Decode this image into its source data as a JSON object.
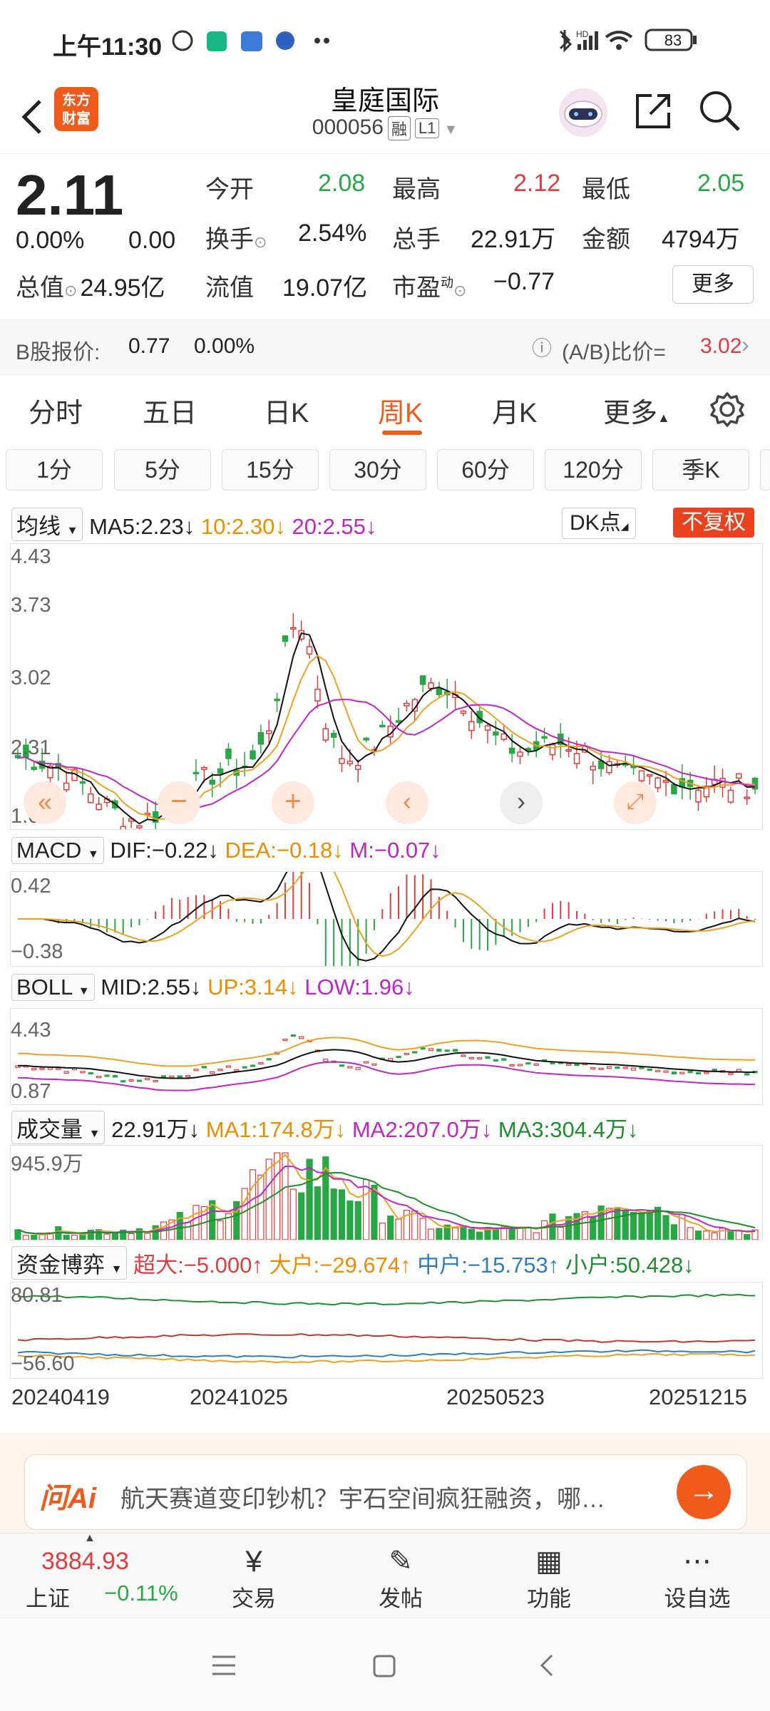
{
  "status_bar": {
    "time": "上午11:30",
    "battery": "83"
  },
  "header": {
    "logo_text_1": "东方",
    "logo_text_2": "财富",
    "title": "皇庭国际",
    "code": "000056",
    "tag_margin": "融",
    "tag_level": "L1"
  },
  "quote": {
    "price": "2.11",
    "change_pct": "0.00%",
    "change": "0.00",
    "open_label": "今开",
    "open": "2.08",
    "high_label": "最高",
    "high": "2.12",
    "low_label": "最低",
    "low": "2.05",
    "turnover_label": "换手",
    "turnover": "2.54%",
    "volume_label": "总手",
    "volume": "22.91万",
    "amount_label": "金额",
    "amount": "4794万",
    "mktcap_label": "总值",
    "mktcap": "24.95亿",
    "float_label": "流值",
    "float": "19.07亿",
    "pe_label": "市盈",
    "pe_sup": "动",
    "pe": "−0.77",
    "more": "更多"
  },
  "b_share": {
    "label": "B股报价:",
    "price": "0.77",
    "pct": "0.00%",
    "ratio_label": "(A/B)比价=",
    "ratio": "3.02"
  },
  "tabs": [
    "分时",
    "五日",
    "日K",
    "周K",
    "月K",
    "更多"
  ],
  "periods": [
    "1分",
    "5分",
    "15分",
    "30分",
    "60分",
    "120分",
    "季K"
  ],
  "kline": {
    "selector": "均线",
    "ma5": "MA5:2.23",
    "ma10": "10:2.30",
    "ma20": "20:2.55",
    "dk": "DK点",
    "fq": "不复权",
    "ticks": [
      "4.43",
      "3.73",
      "3.02",
      "2.31",
      "1.61"
    ]
  },
  "macd": {
    "selector": "MACD",
    "dif": "DIF:−0.22",
    "dea": "DEA:−0.18",
    "m": "M:−0.07",
    "ticks": [
      "0.42",
      "−0.38"
    ]
  },
  "boll": {
    "selector": "BOLL",
    "mid": "MID:2.55",
    "up": "UP:3.14",
    "low": "LOW:1.96",
    "ticks": [
      "4.43",
      "0.87"
    ]
  },
  "vol": {
    "selector": "成交量",
    "value": "22.91万",
    "ma1": "MA1:174.8万",
    "ma2": "MA2:207.0万",
    "ma3": "MA3:304.4万",
    "ticks": [
      "945.9万"
    ]
  },
  "fund": {
    "selector": "资金博弈",
    "super": "超大:−5.000",
    "big": "大户:−29.674",
    "mid": "中户:−15.753",
    "small": "小户:50.428",
    "ticks": [
      "80.81",
      "−56.60"
    ]
  },
  "dates": [
    "20240419",
    "20241025",
    "20250523",
    "20251215"
  ],
  "ai": {
    "logo": "问Ai",
    "text": "航天赛道变印钞机？宇石空间疯狂融资，哪…"
  },
  "bottom_nav": {
    "index_value": "3884.93",
    "index_name": "上证",
    "index_pct": "−0.11%",
    "trade": "交易",
    "post": "发帖",
    "function": "功能",
    "watch": "设自选"
  },
  "colors": {
    "up": "#e33c3c",
    "down": "#28a745",
    "accent": "#f05a1a"
  }
}
